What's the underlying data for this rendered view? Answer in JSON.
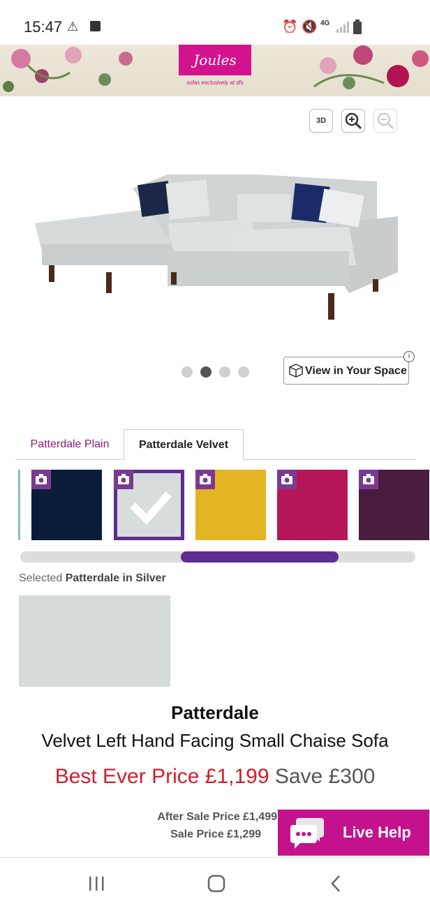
{
  "status_bar": {
    "time": "15:47",
    "network": "4G"
  },
  "banner": {
    "logo_text": "Joules",
    "tagline": "sofas exclusively at dfs"
  },
  "viewer": {
    "btn_3d": "3D",
    "btn_zoom_in_icon": "zoom-in-icon",
    "btn_zoom_out_icon": "zoom-out-icon",
    "view_space_label": "View in Your Space",
    "info_label": "i"
  },
  "carousel": {
    "total": 4,
    "active_index": 1
  },
  "tabs": [
    {
      "label": "Patterdale Plain",
      "active": false
    },
    {
      "label": "Patterdale Velvet",
      "active": true
    }
  ],
  "swatches": [
    {
      "color": "#0b1c3a",
      "selected": false
    },
    {
      "color": "#d7dddd",
      "selected": true
    },
    {
      "color": "#e3b524",
      "selected": false
    },
    {
      "color": "#b7155a",
      "selected": false
    },
    {
      "color": "#4a1d3e",
      "selected": false
    }
  ],
  "selection": {
    "prefix": "Selected",
    "name": "Patterdale in Silver"
  },
  "product": {
    "name": "Patterdale",
    "description": "Velvet Left Hand Facing Small Chaise Sofa",
    "best_price": "Best Ever Price £1,199",
    "save": "Save £300",
    "after_sale": "After Sale Price £1,499",
    "sale_price": "Sale Price £1,299"
  },
  "live_help": {
    "label": "Live Help"
  },
  "colors": {
    "brand_pink": "#d3138d",
    "accent_purple": "#5e2d91",
    "price_red": "#d01f2b"
  }
}
